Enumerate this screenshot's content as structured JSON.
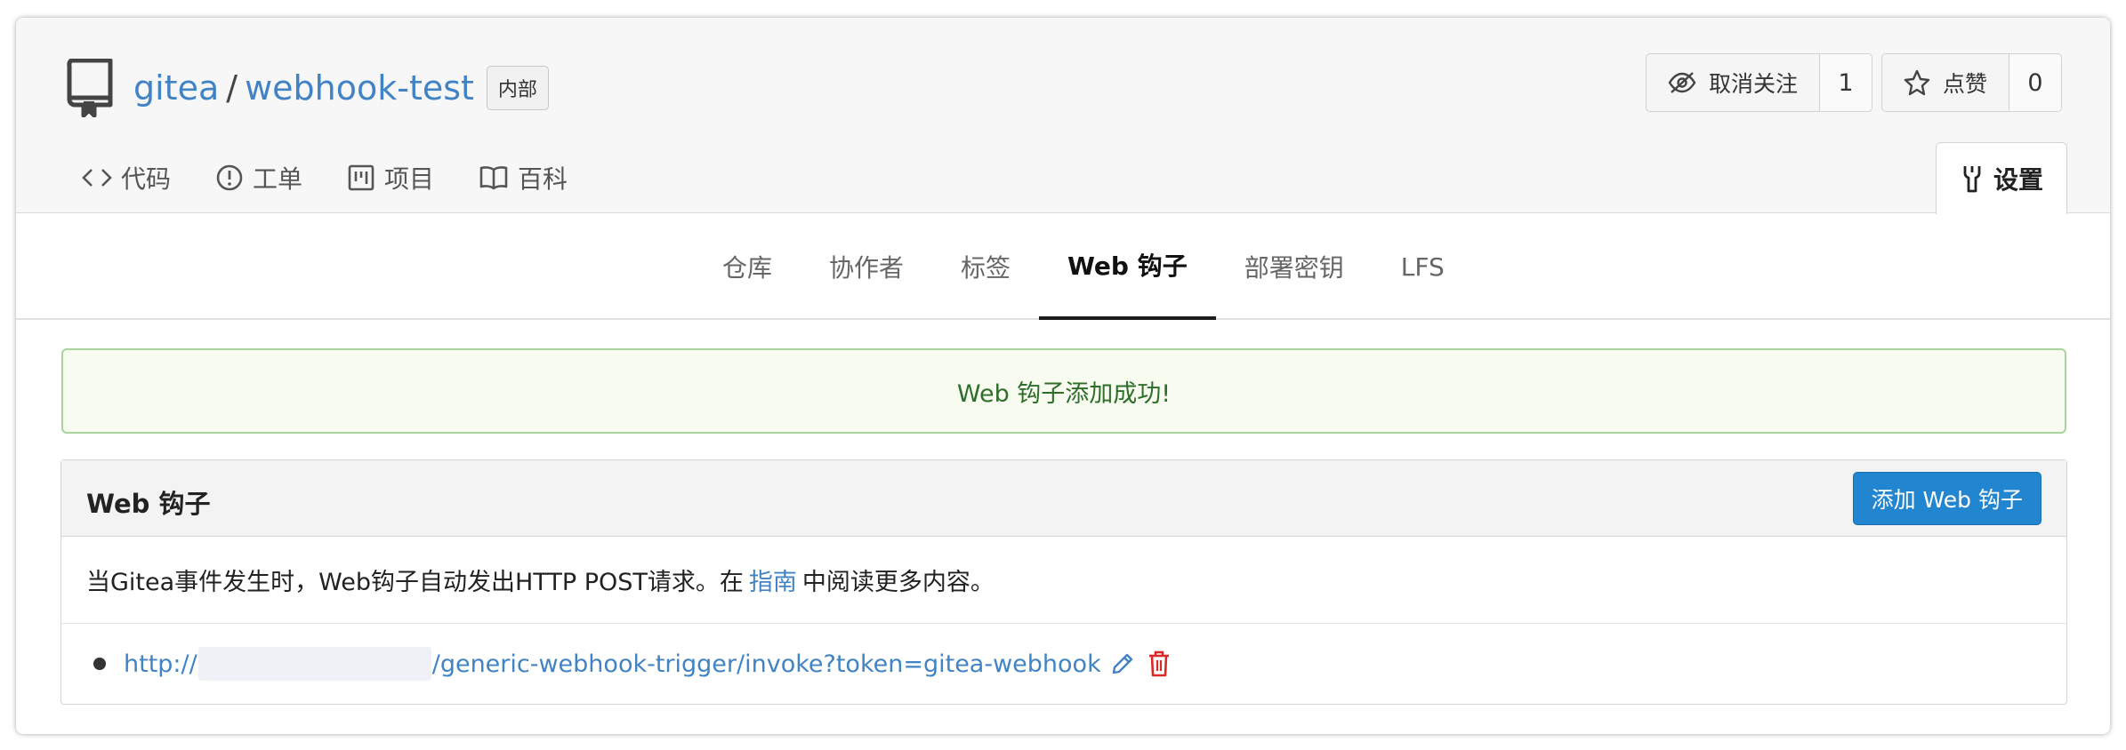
{
  "repo": {
    "owner": "gitea",
    "separator": "/",
    "name": "webhook-test",
    "visibility_badge": "内部"
  },
  "actions": {
    "watch": {
      "label": "取消关注",
      "count": "1"
    },
    "star": {
      "label": "点赞",
      "count": "0"
    }
  },
  "repo_tabs": [
    {
      "label": "代码",
      "icon": "code-icon"
    },
    {
      "label": "工单",
      "icon": "issue-icon"
    },
    {
      "label": "项目",
      "icon": "project-icon"
    },
    {
      "label": "百科",
      "icon": "book-icon"
    }
  ],
  "settings_tab": {
    "label": "设置",
    "icon": "tools-icon"
  },
  "settings_sub_tabs": [
    {
      "label": "仓库",
      "active": false
    },
    {
      "label": "协作者",
      "active": false
    },
    {
      "label": "标签",
      "active": false
    },
    {
      "label": "Web 钩子",
      "active": true
    },
    {
      "label": "部署密钥",
      "active": false
    },
    {
      "label": "LFS",
      "active": false
    }
  ],
  "flash_message": "Web 钩子添加成功!",
  "webhooks_panel": {
    "title": "Web 钩子",
    "add_button": "添加 Web 钩子",
    "description_before": "当Gitea事件发生时，Web钩子自动发出HTTP POST请求。在",
    "description_link": "指南",
    "description_after": "中阅读更多内容。",
    "hooks": [
      {
        "url_prefix": "http://",
        "url_suffix": "/generic-webhook-trigger/invoke?token=gitea-webhook"
      }
    ]
  },
  "colors": {
    "link": "#4183c4",
    "primary_button": "#2185d0",
    "success_text": "#2f6e2a",
    "success_bg": "#f8fbf0",
    "delete_icon": "#db2828"
  }
}
